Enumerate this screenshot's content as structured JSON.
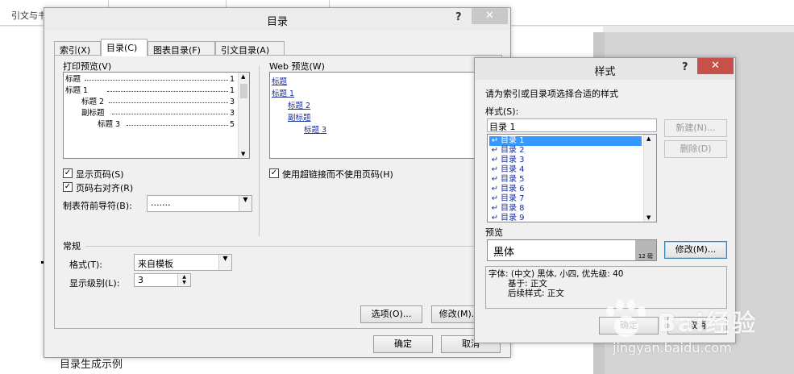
{
  "background": {
    "ribbon_tab": "引文与书目",
    "doc_fragment": "目录生成示例"
  },
  "toc_dialog": {
    "title": "目录",
    "help": "?",
    "close": "✕",
    "tabs": [
      "索引(X)",
      "目录(C)",
      "图表目录(F)",
      "引文目录(A)"
    ],
    "active_tab": 1,
    "print_preview_label": "打印预览(V)",
    "web_preview_label": "Web 预览(W)",
    "print_preview": [
      {
        "text": "标题",
        "page": "1"
      },
      {
        "text": "标题 1",
        "page": "1"
      },
      {
        "text": "标题 2",
        "page": "3"
      },
      {
        "text": "副标题",
        "page": "3"
      },
      {
        "text": "标题 3",
        "page": "5"
      }
    ],
    "web_preview": [
      "标题",
      "标题 1",
      "标题 2",
      "副标题",
      "标题 3"
    ],
    "show_page_numbers": {
      "label": "显示页码(S)",
      "checked": true
    },
    "right_align": {
      "label": "页码右对齐(R)",
      "checked": true
    },
    "use_hyperlinks": {
      "label": "使用超链接而不使用页码(H)",
      "checked": true
    },
    "tab_leader_label": "制表符前导符(B):",
    "tab_leader_value": ".......",
    "general_label": "常规",
    "format_label": "格式(T):",
    "format_value": "来自模板",
    "levels_label": "显示级别(L):",
    "levels_value": "3",
    "options_button": "选项(O)...",
    "modify_button": "修改(M)...",
    "ok_button": "确定",
    "cancel_button": "取消"
  },
  "style_dialog": {
    "title": "样式",
    "help": "?",
    "close": "✕",
    "instruction": "请为索引或目录项选择合适的样式",
    "styles_label": "样式(S):",
    "style_input": "目录 1",
    "styles": [
      "目录 1",
      "目录 2",
      "目录 3",
      "目录 4",
      "目录 5",
      "目录 6",
      "目录 7",
      "目录 8",
      "目录 9"
    ],
    "selected_index": 0,
    "new_button": "新建(N)...",
    "delete_button": "删除(D)",
    "preview_label": "预览",
    "preview_text": "黑体",
    "preview_size": "12 磅",
    "modify_button": "修改(M)...",
    "description": [
      "字体: (中文) 黑体, 小四, 优先级: 40",
      "基于: 正文",
      "后续样式: 正文"
    ],
    "ok_button": "确定",
    "cancel_button": "取消"
  },
  "watermark": {
    "brand": "Bai经验",
    "url": "jingyan.baidu.com"
  }
}
